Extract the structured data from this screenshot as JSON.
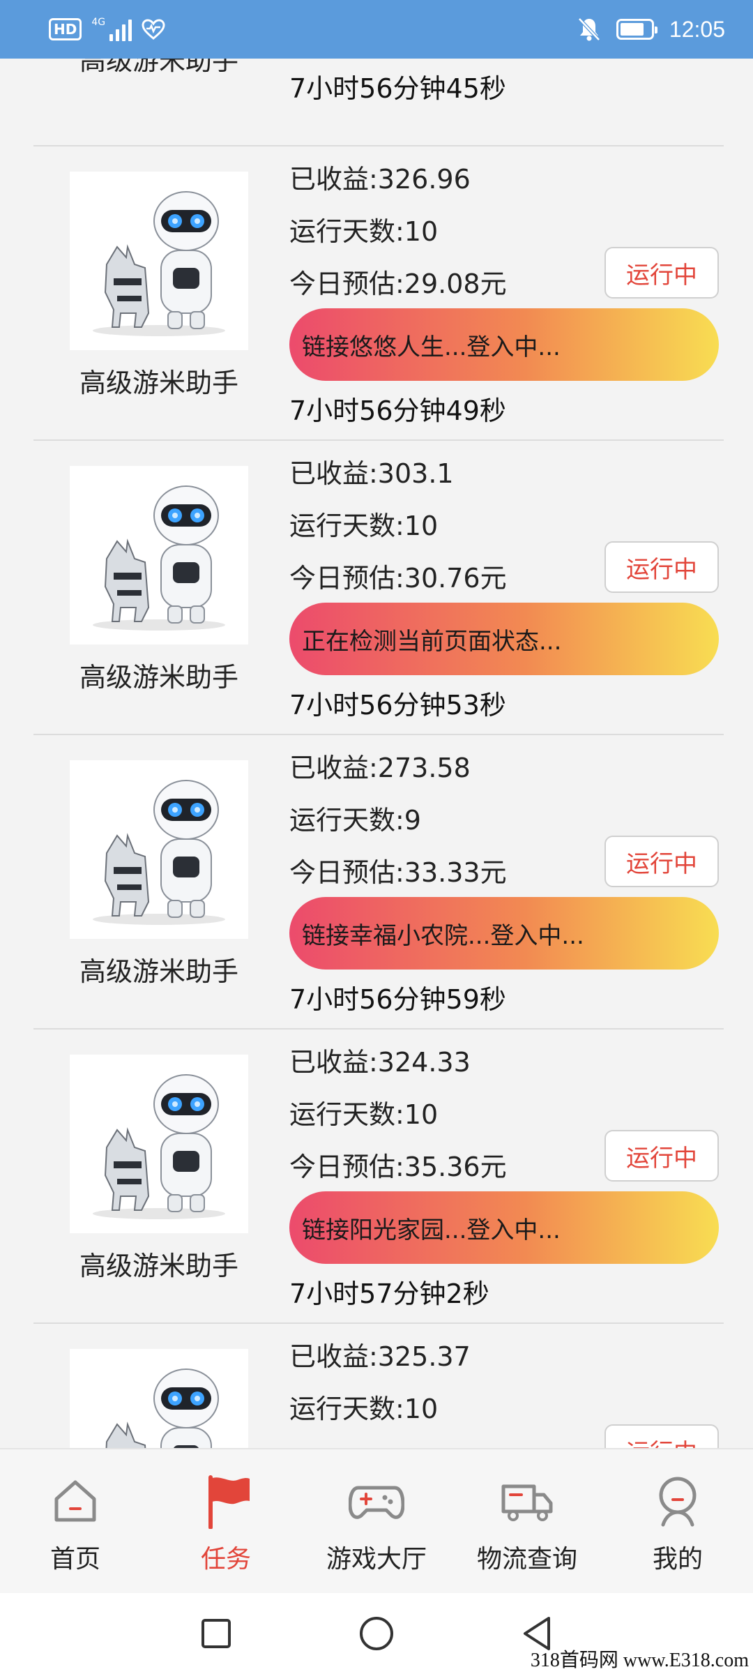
{
  "status_bar": {
    "hd": "HD",
    "network": "4G",
    "time": "12:05"
  },
  "top_partial": {
    "name": "高级游米助手",
    "timer": "7小时56分钟45秒"
  },
  "cards": [
    {
      "earned": "已收益:326.96",
      "days": "运行天数:10",
      "estimate": "今日预估:29.08元",
      "status": "运行中",
      "message": "链接悠悠人生...登入中...",
      "timer": "7小时56分钟49秒",
      "name": "高级游米助手"
    },
    {
      "earned": "已收益:303.1",
      "days": "运行天数:10",
      "estimate": "今日预估:30.76元",
      "status": "运行中",
      "message": "正在检测当前页面状态...",
      "timer": "7小时56分钟53秒",
      "name": "高级游米助手"
    },
    {
      "earned": "已收益:273.58",
      "days": "运行天数:9",
      "estimate": "今日预估:33.33元",
      "status": "运行中",
      "message": "链接幸福小农院...登入中...",
      "timer": "7小时56分钟59秒",
      "name": "高级游米助手"
    },
    {
      "earned": "已收益:324.33",
      "days": "运行天数:10",
      "estimate": "今日预估:35.36元",
      "status": "运行中",
      "message": "链接阳光家园...登入中...",
      "timer": "7小时57分钟2秒",
      "name": "高级游米助手"
    },
    {
      "earned": "已收益:325.37",
      "days": "运行天数:10",
      "status": "运行中"
    }
  ],
  "bottom_nav": [
    {
      "label": "首页",
      "icon": "home-icon",
      "active": false
    },
    {
      "label": "任务",
      "icon": "flag-icon",
      "active": true
    },
    {
      "label": "游戏大厅",
      "icon": "gamepad-icon",
      "active": false
    },
    {
      "label": "物流查询",
      "icon": "truck-icon",
      "active": false
    },
    {
      "label": "我的",
      "icon": "profile-icon",
      "active": false
    }
  ],
  "watermark": "318首码网 www.E318.com",
  "colors": {
    "status_bar": "#5b9bdc",
    "accent_red": "#e2453a",
    "gradient_start": "#ec4b6c",
    "gradient_end": "#f8dd52"
  }
}
